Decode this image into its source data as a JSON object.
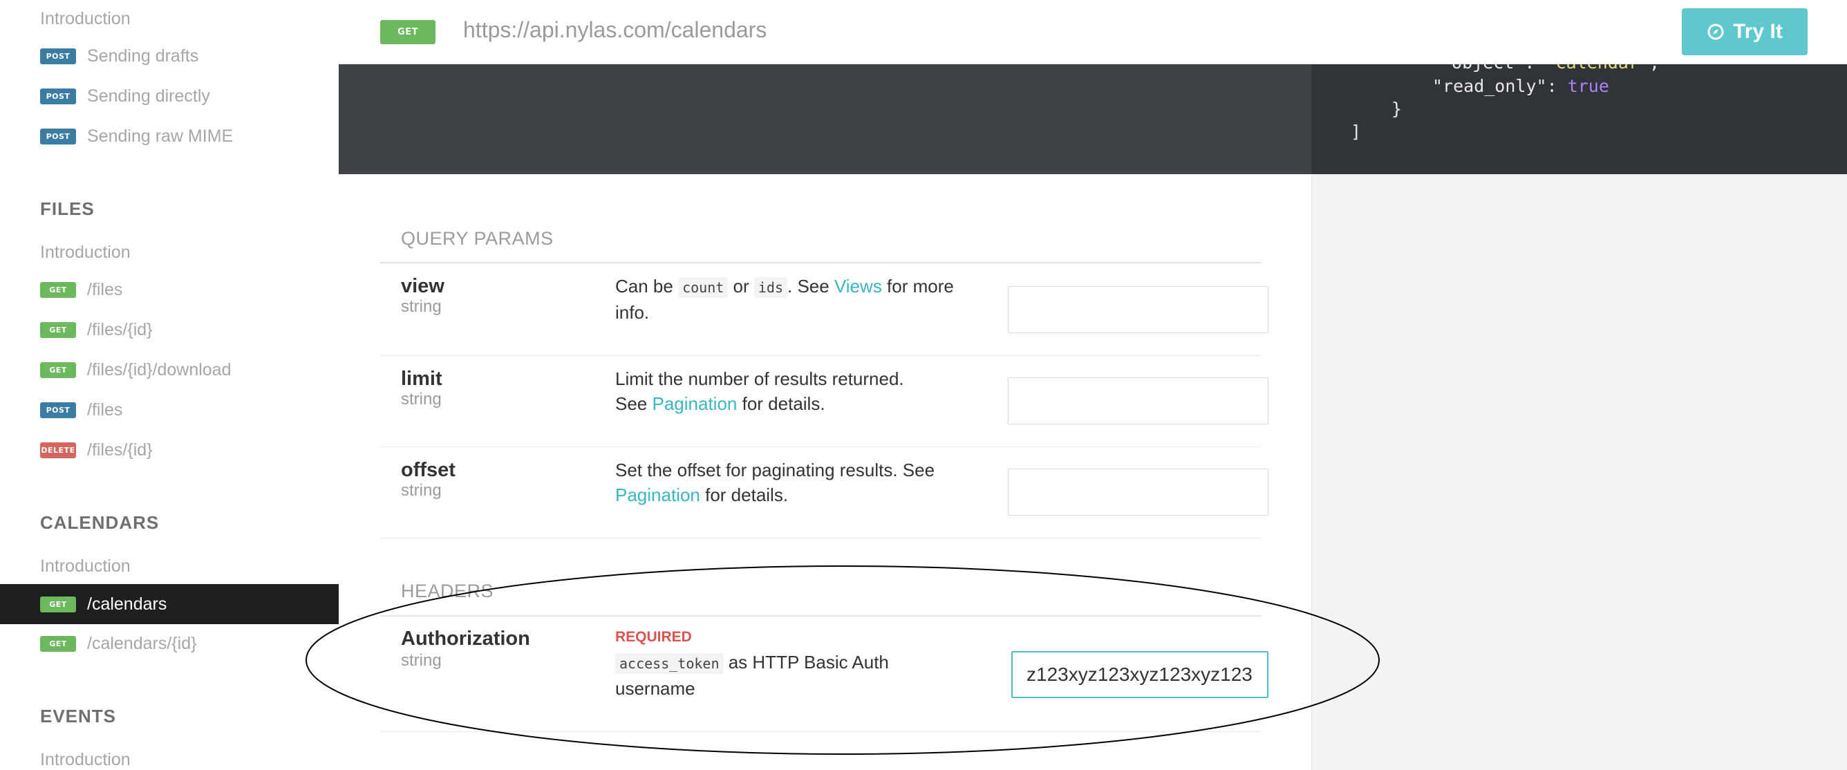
{
  "sidebar": {
    "top_items": [
      {
        "method": "",
        "label": "Introduction"
      },
      {
        "method": "POST",
        "label": "Sending drafts"
      },
      {
        "method": "POST",
        "label": "Sending directly"
      },
      {
        "method": "POST",
        "label": "Sending raw MIME"
      }
    ],
    "files": {
      "title": "FILES",
      "items": [
        {
          "method": "",
          "label": "Introduction"
        },
        {
          "method": "GET",
          "label": "/files"
        },
        {
          "method": "GET",
          "label": "/files/{id}"
        },
        {
          "method": "GET",
          "label": "/files/{id}/download"
        },
        {
          "method": "POST",
          "label": "/files"
        },
        {
          "method": "DELETE",
          "label": "/files/{id}"
        }
      ]
    },
    "calendars": {
      "title": "CALENDARS",
      "items": [
        {
          "method": "",
          "label": "Introduction"
        },
        {
          "method": "GET",
          "label": "/calendars",
          "active": true
        },
        {
          "method": "GET",
          "label": "/calendars/{id}"
        }
      ]
    },
    "events": {
      "title": "EVENTS",
      "items": [
        {
          "method": "",
          "label": "Introduction"
        }
      ]
    }
  },
  "topbar": {
    "method": "GET",
    "url": "https://api.nylas.com/calendars",
    "try_label": "Try It"
  },
  "code": {
    "line1_key": "\"object\"",
    "line1_sep": ": ",
    "line1_val": "\"calendar\"",
    "line1_end": ",",
    "line2_key": "\"read_only\"",
    "line2_sep": ": ",
    "line2_val": "true",
    "line3": "}",
    "line4": "]"
  },
  "query_params": {
    "title": "QUERY PARAMS",
    "params": [
      {
        "name": "view",
        "type": "string",
        "desc_a": "Can be ",
        "code1": "count",
        "desc_b": " or ",
        "code2": "ids",
        "desc_c": ". See ",
        "link": "Views",
        "desc_d": " for more info.",
        "value": ""
      },
      {
        "name": "limit",
        "type": "string",
        "desc_a": "Limit the number of results returned.",
        "desc_b": "See ",
        "link": "Pagination",
        "desc_c": " for details.",
        "value": ""
      },
      {
        "name": "offset",
        "type": "string",
        "desc_a": "Set the offset for paginating results. See ",
        "link": "Pagination",
        "desc_b": " for details.",
        "value": ""
      }
    ]
  },
  "headers": {
    "title": "HEADERS",
    "params": [
      {
        "name": "Authorization",
        "type": "string",
        "required": "REQUIRED",
        "code": "access_token",
        "desc_a": " as HTTP Basic Auth username",
        "value": "z123xyz123xyz123xyz123"
      }
    ]
  }
}
